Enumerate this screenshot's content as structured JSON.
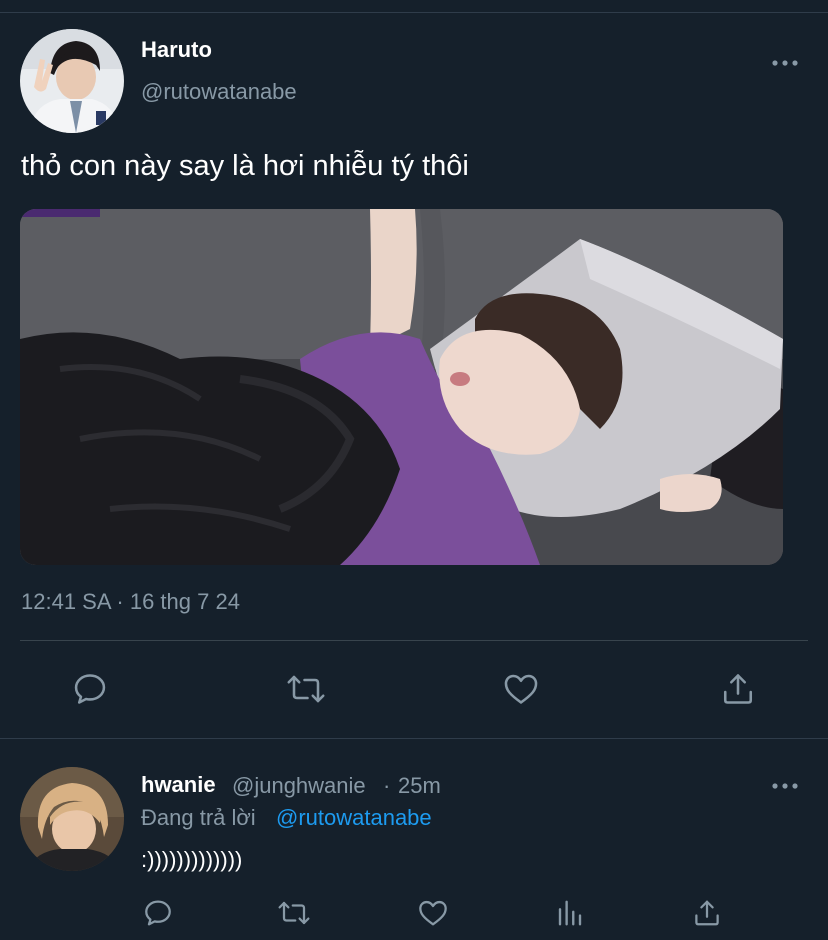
{
  "tweet": {
    "author_name": "Haruto",
    "author_handle": "@rutowatanabe",
    "text": "thỏ con này say là hơi nhiễu tý thôi",
    "timestamp": "12:41 SA · 16 thg 7 24",
    "actions": [
      "reply-icon",
      "retweet-icon",
      "like-icon",
      "share-icon"
    ]
  },
  "reply": {
    "name": "hwanie",
    "handle": "@junghwanie",
    "separator": "·",
    "time": "25m",
    "replying_label": "Đang trả lời",
    "mention": "@rutowatanabe",
    "text": ":)))))))))))))",
    "actions": [
      "reply-icon",
      "retweet-icon",
      "like-icon",
      "analytics-icon",
      "share-icon"
    ]
  },
  "colors": {
    "background": "#15202b",
    "secondary_text": "#8899a6",
    "link": "#1d9bf0",
    "divider": "#38444d",
    "icon": "#8899a6"
  }
}
